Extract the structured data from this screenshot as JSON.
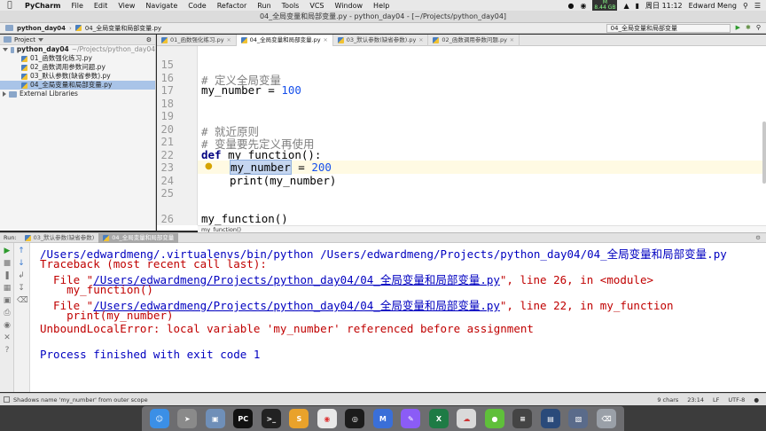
{
  "menubar": {
    "app": "PyCharm",
    "items": [
      "File",
      "Edit",
      "View",
      "Navigate",
      "Code",
      "Refactor",
      "Run",
      "Tools",
      "VCS",
      "Window",
      "Help"
    ],
    "gauge_top": "M",
    "gauge_value": "8.44 GB",
    "date": "周日 11:12",
    "user": "Edward Meng"
  },
  "window": {
    "title": "04_全局变量和局部变量.py - python_day04 - [~/Projects/python_day04]"
  },
  "navbar": {
    "project": "python_day04",
    "file": "04_全局变量和局部变量.py",
    "run_config": "04_全局变量和局部变量"
  },
  "project_panel": {
    "header": "Project",
    "root": "python_day04",
    "root_path": "~/Projects/python_day04",
    "files": [
      "01_函数强化练习.py",
      "02_函数调用参数问题.py",
      "03_默认参数(缺省参数).py",
      "04_全局变量和局部变量.py"
    ],
    "external": "External Libraries"
  },
  "editor_tabs": [
    "01_函数强化练习.py",
    "04_全局变量和局部变量.py",
    "03_默认参数(缺省参数).py",
    "02_函数调用参数问题.py"
  ],
  "editor": {
    "line_numbers": [
      "15",
      "16",
      "17",
      "18",
      "19",
      "20",
      "21",
      "22",
      "23",
      "24",
      "25",
      "26"
    ],
    "comment_global": "# 定义全局变量",
    "assign_name": "my_number = ",
    "assign_value": "100",
    "comment_rule": "# 就近原则",
    "comment_rule2": "# 变量要先定义再使用",
    "def_kw": "def",
    "def_rest": " my_function():",
    "local_name": "my_number",
    "local_rest": " = ",
    "local_value": "200",
    "print_line": "print(my_number)",
    "call_line": "my_function()",
    "breadcrumb": "my_function()"
  },
  "run_panel": {
    "label": "Run:",
    "tabs": [
      "03_默认参数(缺省参数)",
      "04_全局变量和局部变量"
    ],
    "output": {
      "cmd": "/Users/edwardmeng/.virtualenvs/bin/python /Users/edwardmeng/Projects/python_day04/04_全局变量和局部变量.py",
      "traceback": "Traceback (most recent call last):",
      "file1_prefix": "  File \"",
      "file1_link": "/Users/edwardmeng/Projects/python_day04/04_全局变量和局部变量.py",
      "file1_suffix": "\", line 26, in <module>",
      "call1": "    my_function()",
      "file2_prefix": "  File \"",
      "file2_link": "/Users/edwardmeng/Projects/python_day04/04_全局变量和局部变量.py",
      "file2_suffix": "\", line 22, in my_function",
      "call2": "    print(my_number)",
      "error": "UnboundLocalError: local variable 'my_number' referenced before assignment",
      "finished": "Process finished with exit code 1"
    }
  },
  "status": {
    "message": "Shadows name 'my_number' from outer scope",
    "chars": "9 chars",
    "position": "23:14",
    "line_sep": "LF",
    "encoding": "UTF-8"
  },
  "dock": {
    "pycharm_label": "PC"
  }
}
